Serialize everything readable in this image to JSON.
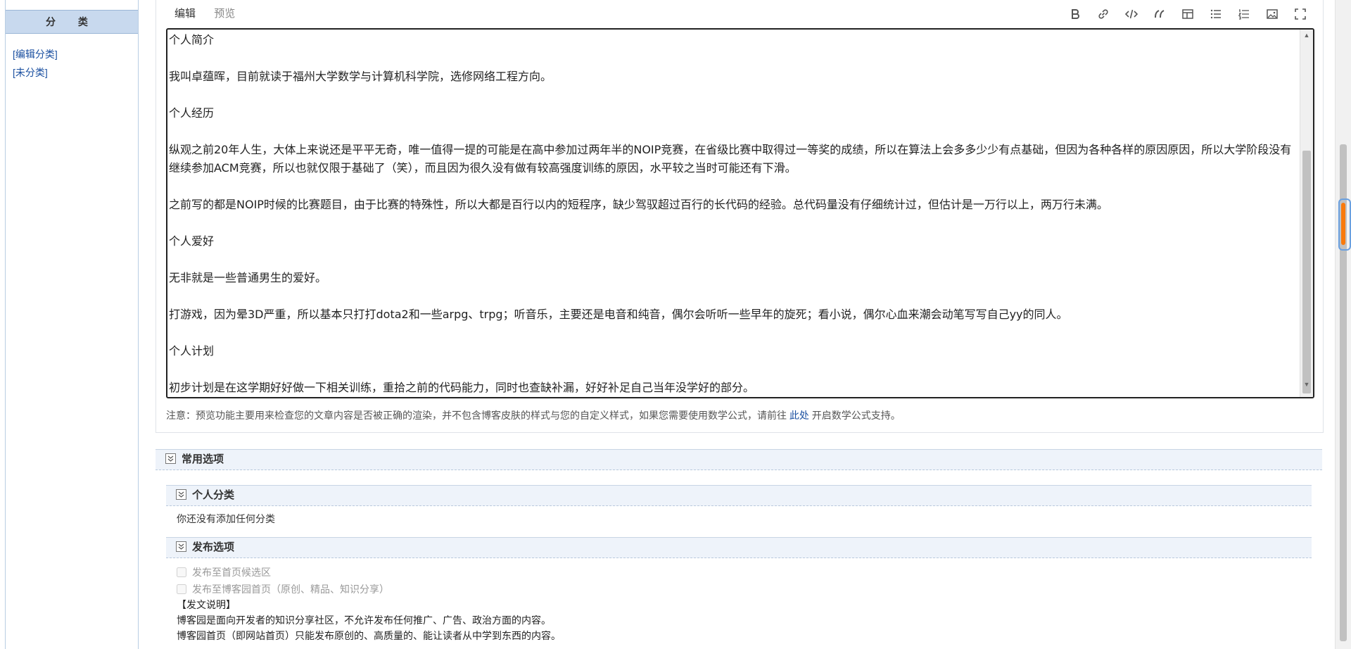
{
  "sidebar": {
    "header": "分 类",
    "links": [
      "[编辑分类]",
      "[未分类]"
    ]
  },
  "editor": {
    "tabs": [
      "编辑",
      "预览"
    ],
    "toolbar": [
      "bold-icon",
      "link-icon",
      "code-icon",
      "quote-icon",
      "table-icon",
      "bullet-list-icon",
      "numbered-list-icon",
      "image-icon",
      "fullscreen-icon"
    ],
    "content": [
      "个人简介",
      "",
      "我叫卓蕴晖，目前就读于福州大学数学与计算机科学院，选修网络工程方向。",
      "",
      "个人经历",
      "",
      "纵观之前20年人生，大体上来说还是平平无奇，唯一值得一提的可能是在高中参加过两年半的NOIP竞赛，在省级比赛中取得过一等奖的成绩，所以在算法上会多多少少有点基础，但因为各种各样的原因原因，所以大学阶段没有继续参加ACM竞赛，所以也就仅限于基础了（笑），而且因为很久没有做有较高强度训练的原因，水平较之当时可能还有下滑。",
      "",
      "之前写的都是NOIP时候的比赛题目，由于比赛的特殊性，所以大都是百行以内的短程序，缺少驾驭超过百行的长代码的经验。总代码量没有仔细统计过，但估计是一万行以上，两万行未满。",
      "",
      "个人爱好",
      "",
      "无非就是一些普通男生的爱好。",
      "",
      "打游戏，因为晕3D严重，所以基本只打打dota2和一些arpg、trpg；听音乐，主要还是电音和纯音，偶尔会听听一些早年的旋死；看小说，偶尔心血来潮会动笔写写自己yy的同人。",
      "",
      "个人计划",
      "",
      "初步计划是在这学期好好做一下相关训练，重拾之前的代码能力，同时也查缺补漏，好好补足自己当年没学好的部分。"
    ],
    "note_prefix": "注意：预览功能主要用来检查您的文章内容是否被正确的渲染，并不包含博客皮肤的样式与您的自定义样式，如果您需要使用数学公式，请前往 ",
    "note_link": "此处",
    "note_suffix": " 开启数学公式支持。"
  },
  "options": {
    "common_title": "常用选项",
    "category_title": "个人分类",
    "category_empty": "你还没有添加任何分类",
    "publish_title": "发布选项",
    "checkbox_1": "发布至首页候选区",
    "checkbox_2": "发布至博客园首页（原创、精品、知识分享）",
    "explain_title": "【发文说明】",
    "explain_1": "博客园是面向开发者的知识分享社区，不允许发布任何推广、广告、政治方面的内容。",
    "explain_2": "博客园首页（即网站首页）只能发布原创的、高质量的、能让读者从中学到东西的内容。"
  }
}
